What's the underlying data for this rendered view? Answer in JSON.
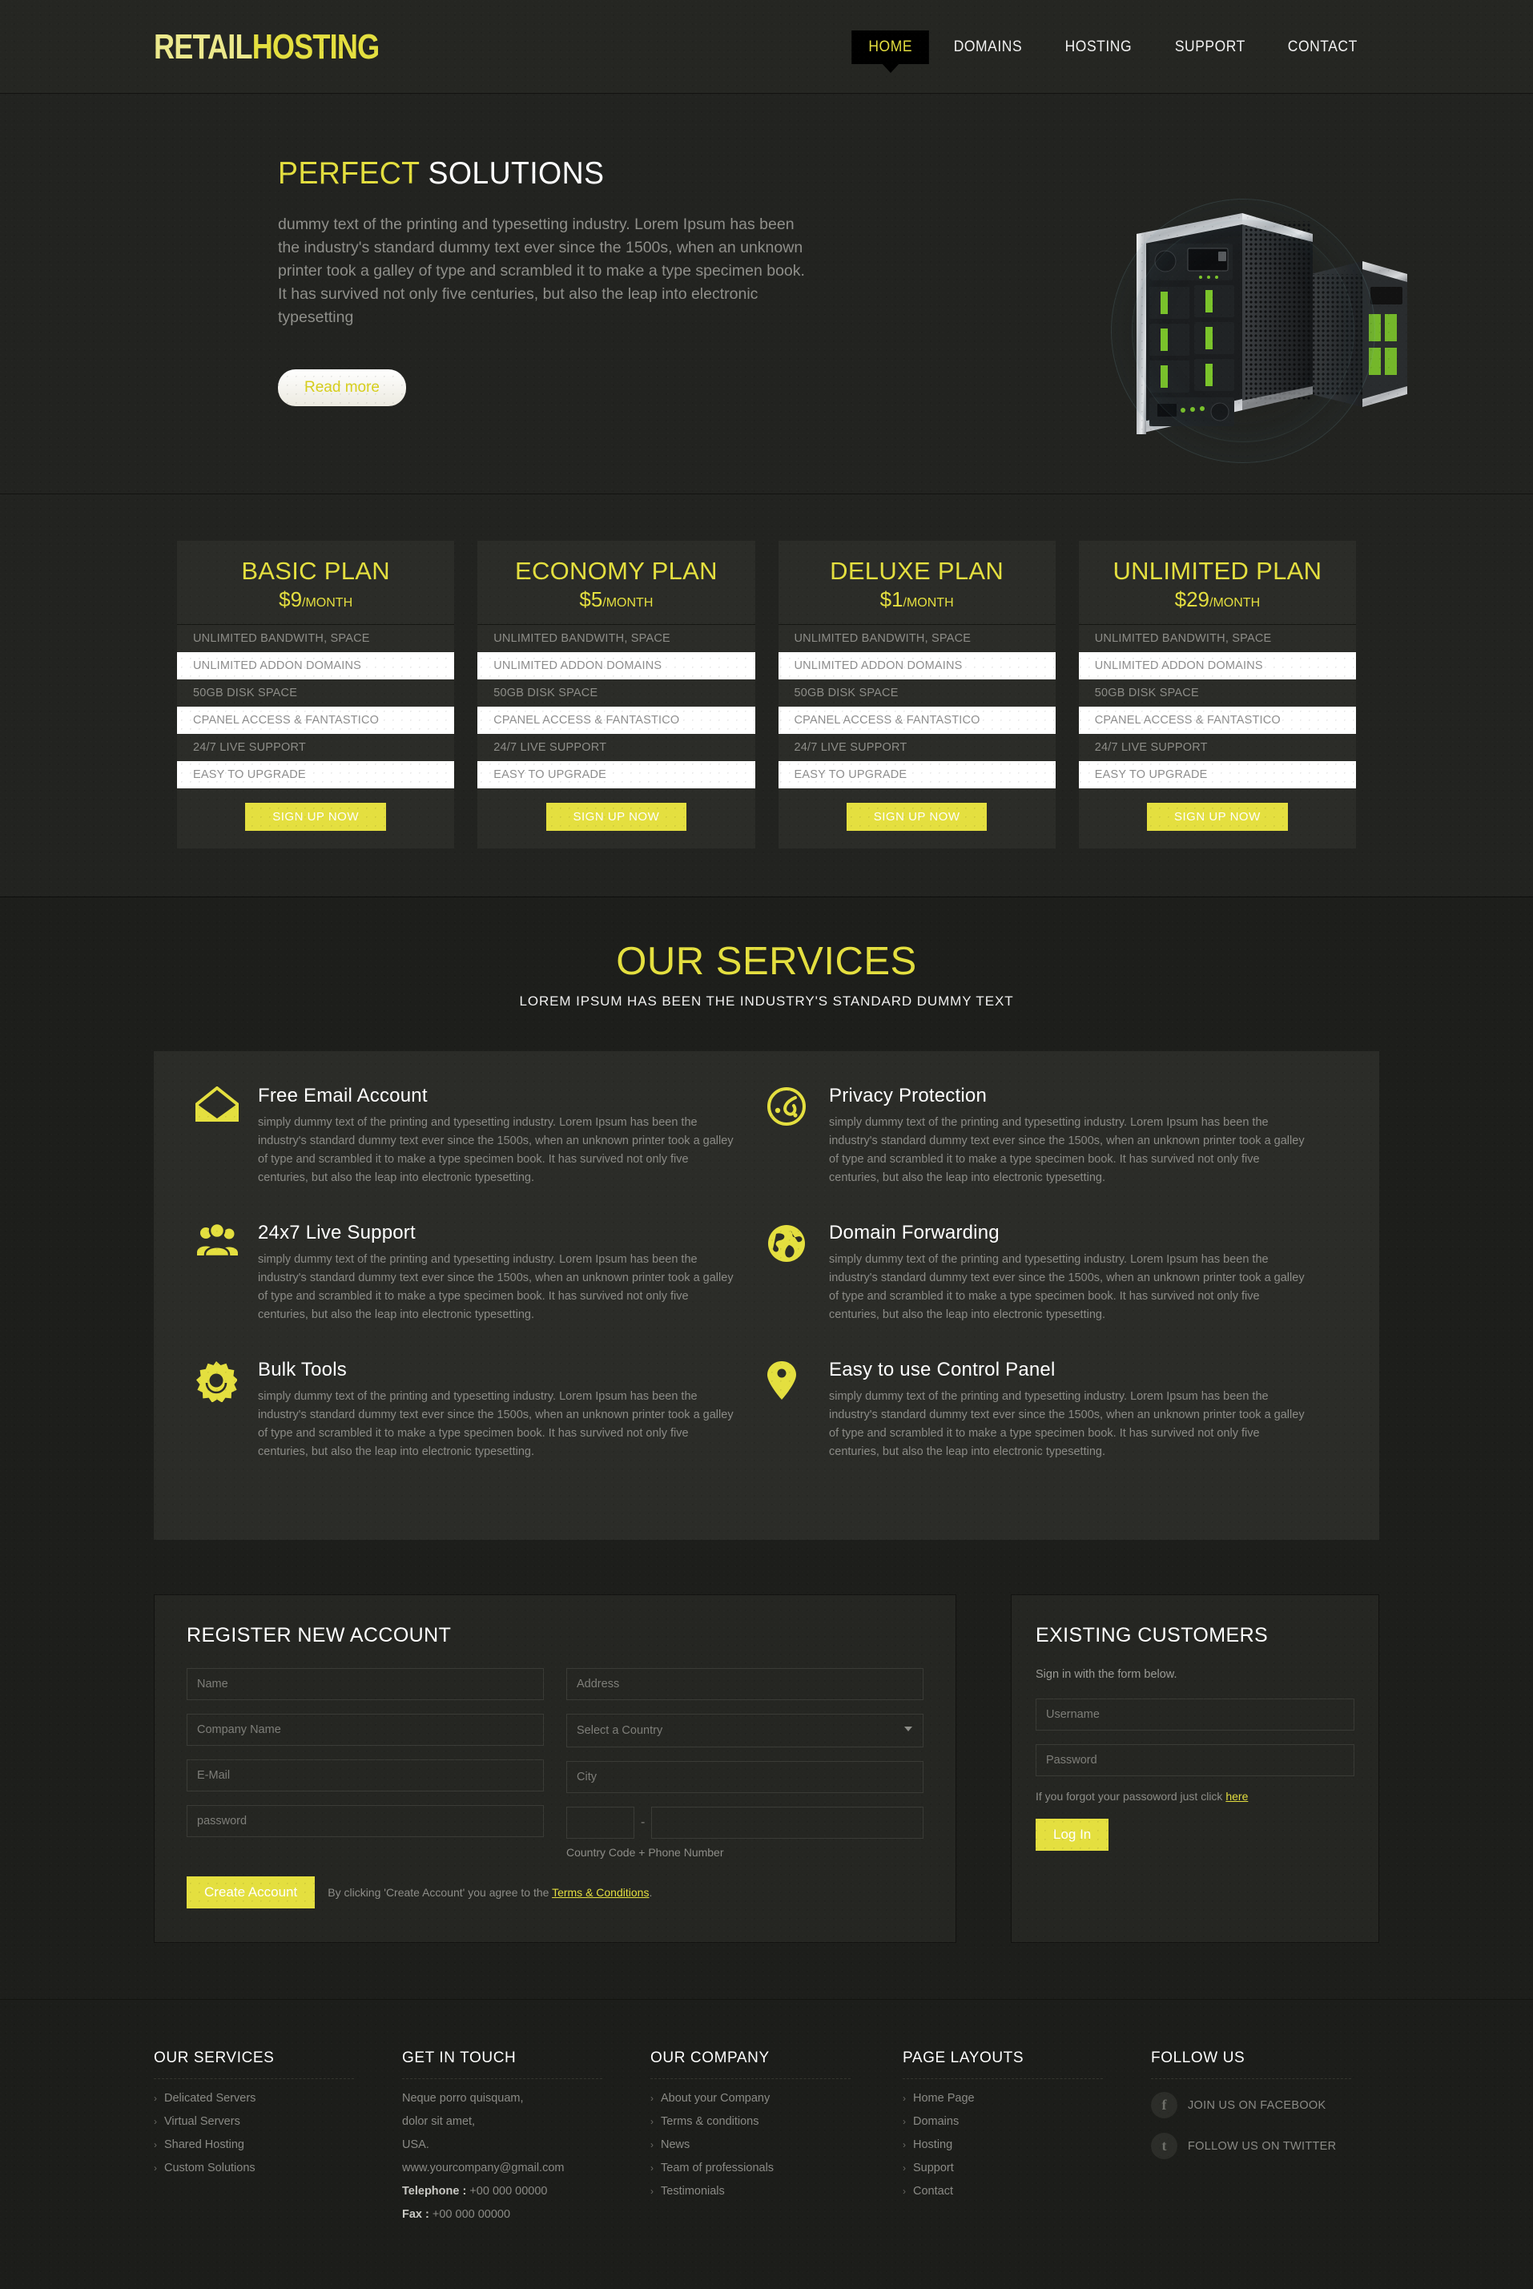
{
  "colors": {
    "accent": "#e4df3f",
    "page_bg": "#1e1f1d",
    "panel_bg": "#2b2c28",
    "text": "#8d8d88"
  },
  "header": {
    "logo_part1": "RETAIL",
    "logo_part2": "HOSTING",
    "nav": [
      {
        "label": "HOME",
        "active": true
      },
      {
        "label": "DOMAINS",
        "active": false
      },
      {
        "label": "HOSTING",
        "active": false
      },
      {
        "label": "SUPPORT",
        "active": false
      },
      {
        "label": "CONTACT",
        "active": false
      }
    ]
  },
  "hero": {
    "title_highlight": "PERFECT",
    "title_rest": " SOLUTIONS",
    "paragraph": "dummy text of the printing and typesetting industry. Lorem Ipsum has been the industry's standard dummy text ever since the 1500s, when an unknown printer took a galley of type and scrambled it to make a type specimen book. It has survived not only five centuries, but also the leap into electronic typesetting",
    "cta_label": "Read more",
    "image_alt": "server-tower-image"
  },
  "pricing": {
    "plans": [
      {
        "name": "BASIC PLAN",
        "price": "$9",
        "per": "/MONTH",
        "features": [
          "UNLIMITED BANDWITH, SPACE",
          "UNLIMITED ADDON DOMAINS",
          "50GB DISK SPACE",
          "CPANEL ACCESS & FANTASTICO",
          "24/7 LIVE SUPPORT",
          "EASY TO UPGRADE"
        ],
        "cta": "SIGN UP NOW"
      },
      {
        "name": "ECONOMY PLAN",
        "price": "$5",
        "per": "/MONTH",
        "features": [
          "UNLIMITED BANDWITH, SPACE",
          "UNLIMITED ADDON DOMAINS",
          "50GB DISK SPACE",
          "CPANEL ACCESS & FANTASTICO",
          "24/7 LIVE SUPPORT",
          "EASY TO UPGRADE"
        ],
        "cta": "SIGN UP NOW"
      },
      {
        "name": "DELUXE PLAN",
        "price": "$1",
        "per": "/MONTH",
        "features": [
          "UNLIMITED BANDWITH, SPACE",
          "UNLIMITED ADDON DOMAINS",
          "50GB DISK SPACE",
          "CPANEL ACCESS & FANTASTICO",
          "24/7 LIVE SUPPORT",
          "EASY TO UPGRADE"
        ],
        "cta": "SIGN UP NOW"
      },
      {
        "name": "UNLIMITED PLAN",
        "price": "$29",
        "per": "/MONTH",
        "features": [
          "UNLIMITED BANDWITH, SPACE",
          "UNLIMITED ADDON DOMAINS",
          "50GB DISK SPACE",
          "CPANEL ACCESS & FANTASTICO",
          "24/7 LIVE SUPPORT",
          "EASY TO UPGRADE"
        ],
        "cta": "SIGN UP NOW"
      }
    ]
  },
  "services": {
    "title": "OUR SERVICES",
    "subtitle": "LOREM IPSUM HAS BEEN THE INDUSTRY'S STANDARD DUMMY TEXT",
    "body_text": "simply dummy text of the printing and typesetting industry. Lorem Ipsum has been the industry's standard dummy text ever since the 1500s, when an unknown printer took a galley of type and scrambled it to make a type specimen book. It has survived not only five centuries, but also the leap into electronic typesetting.",
    "items": [
      {
        "icon": "envelope-icon",
        "title": "Free Email Account"
      },
      {
        "icon": "privacy-shield-icon",
        "title": "Privacy Protection"
      },
      {
        "icon": "people-group-icon",
        "title": "24x7 Live Support"
      },
      {
        "icon": "globe-icon",
        "title": "Domain Forwarding"
      },
      {
        "icon": "gear-icon",
        "title": "Bulk Tools"
      },
      {
        "icon": "map-pin-icon",
        "title": "Easy to use Control Panel"
      }
    ]
  },
  "register": {
    "heading": "REGISTER NEW ACCOUNT",
    "name_placeholder": "Name",
    "company_placeholder": "Company Name",
    "email_placeholder": "E-Mail",
    "password_placeholder": "password",
    "address_placeholder": "Address",
    "country_placeholder": "Select a Country",
    "city_placeholder": "City",
    "phone_label": "Country Code + Phone Number",
    "phone_separator": "-",
    "submit_label": "Create Account",
    "terms_prefix": "By clicking 'Create Account' you agree to the ",
    "terms_link": "Terms & Conditions",
    "terms_suffix": "."
  },
  "existing": {
    "heading": "EXISTING CUSTOMERS",
    "note": "Sign in with the form below.",
    "username_placeholder": "Username",
    "password_placeholder": "Password",
    "forgot_prefix": "If you forgot your passoword just click ",
    "forgot_link": "here",
    "login_label": "Log In"
  },
  "footer": {
    "columns": [
      {
        "heading": "OUR SERVICES",
        "type": "links",
        "links": [
          "Delicated Servers",
          "Virtual Servers",
          "Shared Hosting",
          "Custom Solutions"
        ]
      },
      {
        "heading": "GET IN TOUCH",
        "type": "address",
        "lines": [
          "Neque porro quisquam,",
          "dolor sit amet,",
          "USA.",
          "www.yourcompany@gmail.com"
        ],
        "telephone_label": "Telephone : ",
        "telephone_value": "+00 000 00000",
        "fax_label": "Fax : ",
        "fax_value": "+00 000 00000"
      },
      {
        "heading": "OUR COMPANY",
        "type": "links",
        "links": [
          "About your Company",
          "Terms & conditions",
          "News",
          "Team of professionals",
          "Testimonials"
        ]
      },
      {
        "heading": "PAGE LAYOUTS",
        "type": "links",
        "links": [
          "Home Page",
          "Domains",
          "Hosting",
          "Support",
          "Contact"
        ]
      },
      {
        "heading": "FOLLOW US",
        "type": "social",
        "social": [
          {
            "icon": "facebook-icon",
            "glyph": "f",
            "label": "JOIN US ON FACEBOOK"
          },
          {
            "icon": "twitter-icon",
            "glyph": "t",
            "label": "FOLLOW US ON TWITTER"
          }
        ]
      }
    ]
  }
}
